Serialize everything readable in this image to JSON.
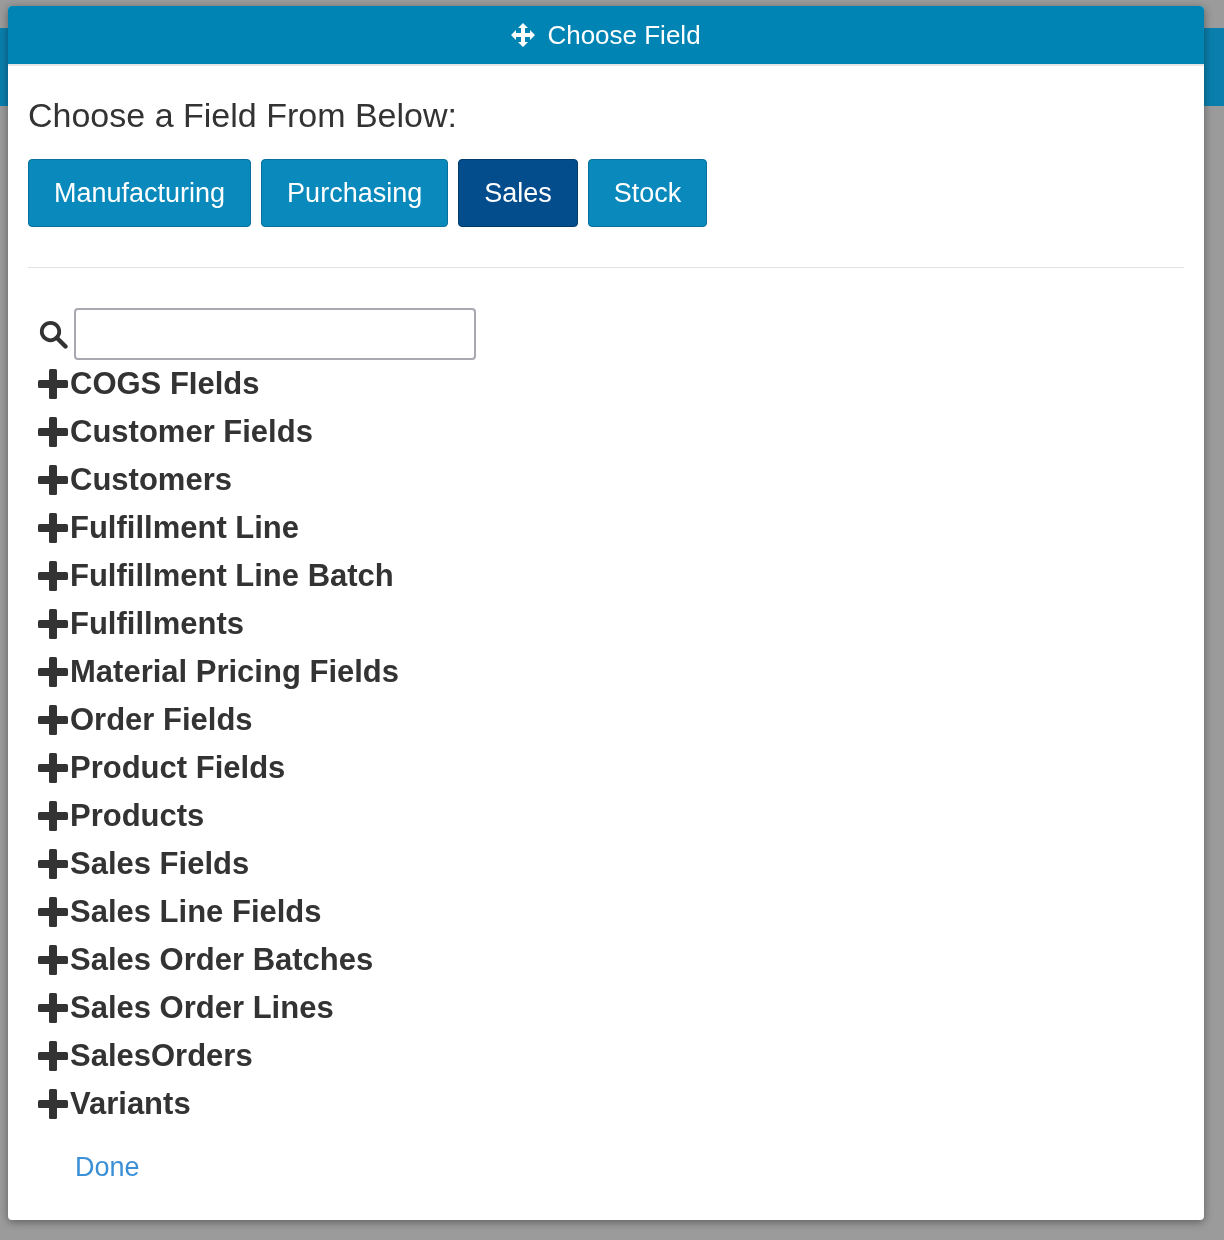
{
  "dialog": {
    "title": "Choose Field"
  },
  "heading": "Choose a Field From Below:",
  "tabs": [
    {
      "label": "Manufacturing",
      "selected": false
    },
    {
      "label": "Purchasing",
      "selected": false
    },
    {
      "label": "Sales",
      "selected": true
    },
    {
      "label": "Stock",
      "selected": false
    }
  ],
  "tree": {
    "items": [
      {
        "label": "COGS FIelds",
        "expanded": false
      },
      {
        "label": "Customer Fields",
        "expanded": false
      },
      {
        "label": "Customers",
        "expanded": false
      },
      {
        "label": "Fulfillment Line",
        "expanded": false
      },
      {
        "label": "Fulfillment Line Batch",
        "expanded": false
      },
      {
        "label": "Fulfillments",
        "expanded": false
      },
      {
        "label": "Material Pricing Fields",
        "expanded": false
      },
      {
        "label": "Order Fields",
        "expanded": false
      },
      {
        "label": "Product Fields",
        "expanded": false
      },
      {
        "label": "Products",
        "expanded": false
      },
      {
        "label": "Sales Fields",
        "expanded": false
      },
      {
        "label": "Sales Line Fields",
        "expanded": false
      },
      {
        "label": "Sales Order Batches",
        "expanded": false
      },
      {
        "label": "Sales Order Lines",
        "expanded": false
      },
      {
        "label": "SalesOrders",
        "expanded": false
      },
      {
        "label": "Variants",
        "expanded": false
      }
    ]
  },
  "done": "Done"
}
